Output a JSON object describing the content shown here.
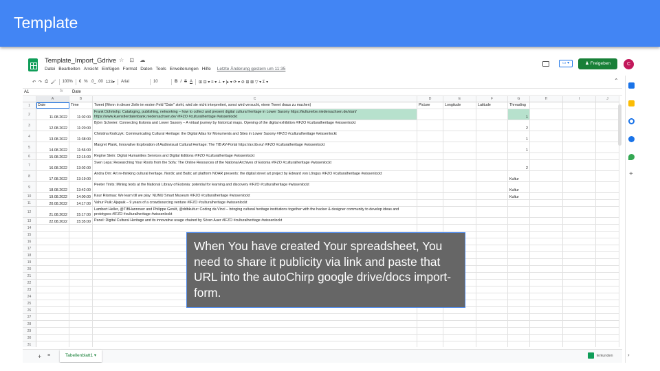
{
  "slide": {
    "title": "Template",
    "header_color": "#4285f4",
    "callout_text": "When You have created Your spreadsheet, You need to share it publicity via link and paste that URL into the autoChirp google drive/docs import-form."
  },
  "sheet": {
    "doc_title": "Template_Import_Gdrive",
    "title_icons": "☆ ⊡ ☁",
    "menu": [
      "Datei",
      "Bearbeiten",
      "Ansicht",
      "Einfügen",
      "Format",
      "Daten",
      "Tools",
      "Erweiterungen",
      "Hilfe"
    ],
    "last_edit": "Letzte Änderung gestern um 11:35",
    "share_label": "Freigeben",
    "avatar_initial": "C",
    "present_label": "▭ ▾",
    "toolbar": {
      "zoom": "100%",
      "currency": "€",
      "percent": "%",
      "decimals": ".0_ .00",
      "number_format": "123▾",
      "font": "Arial",
      "font_size": "10",
      "bold": "B",
      "italic": "I",
      "strike": "S",
      "text_color": "A",
      "tools_right": "⊞ ⊟ ▾ ≡ ▾ ⊥ ▾ |▸ ▾ ⟳ ▾ ⊘ ⊞ ⊠ ▽ ▾ Σ ▾"
    },
    "cell_ref": "A1",
    "formula_value": "Date",
    "columns": [
      "A",
      "B",
      "C",
      "D",
      "E",
      "F",
      "G",
      "H",
      "I",
      "J"
    ],
    "headers": [
      "Date",
      "Time",
      "Tweet (Wenn in dieser Zeile im ersten Feld \"Date\" steht, wird sie nicht interpretiert, sonst wird versucht, einen Tweet draus zu machen)",
      "Picture",
      "Longitude",
      "Latitude",
      "Threading",
      "",
      "",
      ""
    ],
    "rows": [
      {
        "num": "2",
        "date": "11.08.2022",
        "time": "11:02:00",
        "tweet": "Frank Dührkohp: Cataloging, publishing, networking – how to collect and present digital cultural heritage in Lower Saxony https://kulturerbe.niedersachsen.de/start/  https://www.kuenstlerdatenbank.niedersachsen.de/ #IFZO #culturalheritage #wissenlockt",
        "threading": "1"
      },
      {
        "num": "3",
        "date": "12.08.2022",
        "time": "11:20:00",
        "tweet": "Björn Schreier: Connecting Estonia and Lower Saxony – A virtual journey by historical maps. Opening of the digital exhibition #IFZO #culturalheritage #wissenlockt",
        "threading": "2"
      },
      {
        "num": "4",
        "date": "13.08.2022",
        "time": "11:38:00",
        "tweet": "Christina Krafczyk: Communicating Cultural Heritage: the Digital Atlas for Monuments and Sites in Lower Saxony #IFZO #culturalheritage #wissenlockt",
        "threading": "1"
      },
      {
        "num": "5",
        "date": "14.08.2022",
        "time": "11:56:00",
        "tweet": "Margret Plank, Innovative Exploration of Audiovisual Cultural Heritage: The TIB AV-Portal https://av.tib.eu/  #IFZO #culturalheritage #wissenlockt",
        "threading": "1"
      },
      {
        "num": "6",
        "date": "15.08.2022",
        "time": "12:15:00",
        "tweet": "Regine Stein: Digital Humanities Services and Digital Editions #IFZO #culturalheritage #wissenlockt",
        "threading": ""
      },
      {
        "num": "7",
        "date": "16.08.2022",
        "time": "13:02:00",
        "tweet": "Sven Lepa: Researching Your Roots from the Sofa: The Online Resources of the National Archives of Estonia #IFZO #culturalheritage #wissenlockt",
        "threading": "2"
      },
      {
        "num": "8",
        "date": "17.08.2022",
        "time": "13:19:00",
        "tweet": "Andra Orn: Art re-thinking cultural heritage. Nordic and Baltic art platform NOAR presents: the digital street art project by Edward von Lõngus #IFZO #culturalheritage #wissenlockt",
        "threading": "Kultur"
      },
      {
        "num": "9",
        "date": "18.08.2022",
        "time": "13:42:00",
        "tweet": "Peeter Tinits: Mining texts at the National Library of Estonia: potential for learning and discovery #IFZO #culturalheritage #wissenlockt",
        "threading": "Kultur"
      },
      {
        "num": "10",
        "date": "19.08.2022",
        "time": "14:00:00",
        "tweet": "Kaur Riismaa: We learn till we play: NUMU Smart Museum #IFZO #culturalheritage #wissenlockt",
        "threading": "Kultur"
      },
      {
        "num": "11",
        "date": "20.08.2022",
        "time": "14:17:00",
        "tweet": "Vahur Puik: Ajapaik – 9 years of a crowdsourcing venture #IFZO #culturalheritage #wissenlockt",
        "threading": ""
      },
      {
        "num": "12",
        "date": "21.08.2022",
        "time": "15:17:00",
        "tweet": "Lambert Heller, @TIBHannover and Philippe Genêt, @ddbkultur: Coding da Vinci – bringing cultural heritage institutions together with the hacker & designer community to develop ideas and prototypes #IFZO #culturalheritage #wissenlockt",
        "threading": ""
      },
      {
        "num": "13",
        "date": "22.08.2022",
        "time": "15:35:00",
        "tweet": "Panel: Digital Cultural Heritage and its innovative usage chaired by Sören Auer #IFZO #culturalheritage #wissenlockt",
        "threading": ""
      }
    ],
    "empty_rows": [
      "14",
      "15",
      "16",
      "17",
      "18",
      "19",
      "20",
      "21",
      "22",
      "23",
      "24",
      "25",
      "26",
      "27",
      "28",
      "29",
      "30",
      "31"
    ],
    "header_rownum": "1",
    "sheet_tab": "Tabellenblatt1",
    "add_sheet": "+",
    "all_sheets": "≡",
    "explore_label": "Erkunden",
    "green_fill": "#b7e1cd",
    "accent_green": "#188038"
  }
}
